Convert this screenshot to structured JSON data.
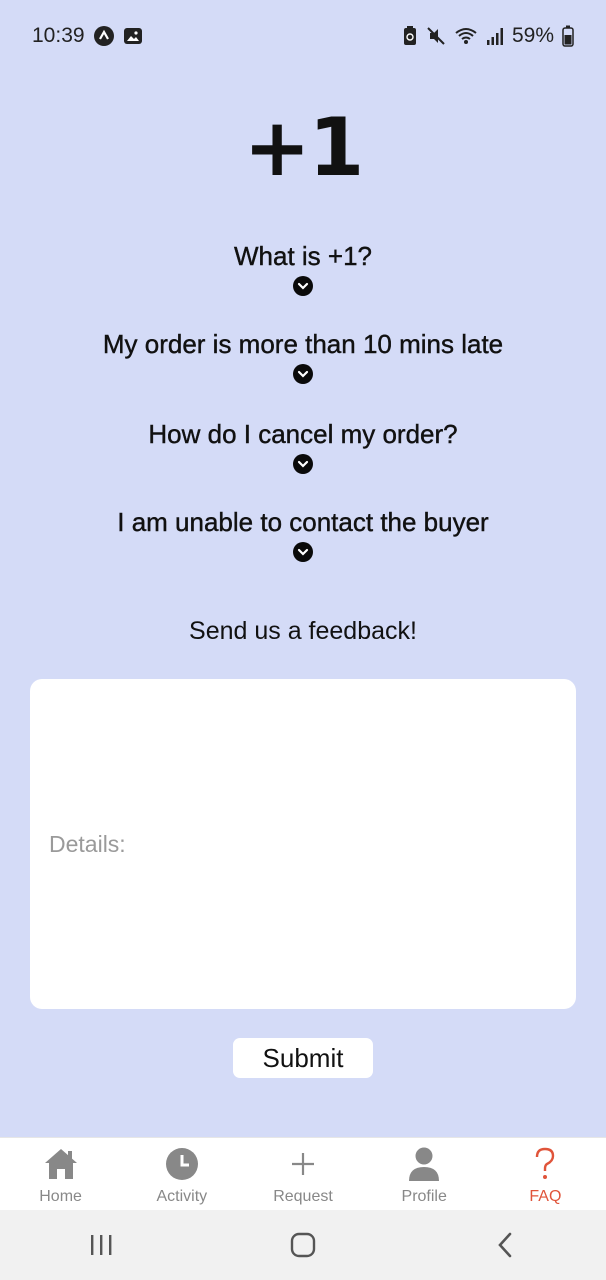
{
  "status_bar": {
    "time": "10:39",
    "battery": "59%",
    "left_icons": [
      "app-notification-icon",
      "image-icon"
    ],
    "right_icons": [
      "battery-saver-icon",
      "mute-icon",
      "wifi-icon",
      "signal-icon",
      "battery-icon"
    ]
  },
  "app": {
    "title": "+1"
  },
  "faq": {
    "items": [
      {
        "question": "What is +1?"
      },
      {
        "question": "My order is more than 10 mins late"
      },
      {
        "question": "How do I cancel my order?"
      },
      {
        "question": "I am unable to contact the buyer"
      }
    ]
  },
  "feedback": {
    "title": "Send us a feedback!",
    "details_placeholder": "Details:",
    "submit_label": "Submit"
  },
  "tab_bar": {
    "tabs": [
      {
        "label": "Home",
        "icon": "home-icon",
        "active": false
      },
      {
        "label": "Activity",
        "icon": "clock-icon",
        "active": false
      },
      {
        "label": "Request",
        "icon": "plus-icon",
        "active": false
      },
      {
        "label": "Profile",
        "icon": "person-icon",
        "active": false
      },
      {
        "label": "FAQ",
        "icon": "question-icon",
        "active": true
      }
    ]
  },
  "colors": {
    "background": "#d4dbf7",
    "active_tab": "#e0543a",
    "inactive_tab": "#888888"
  }
}
